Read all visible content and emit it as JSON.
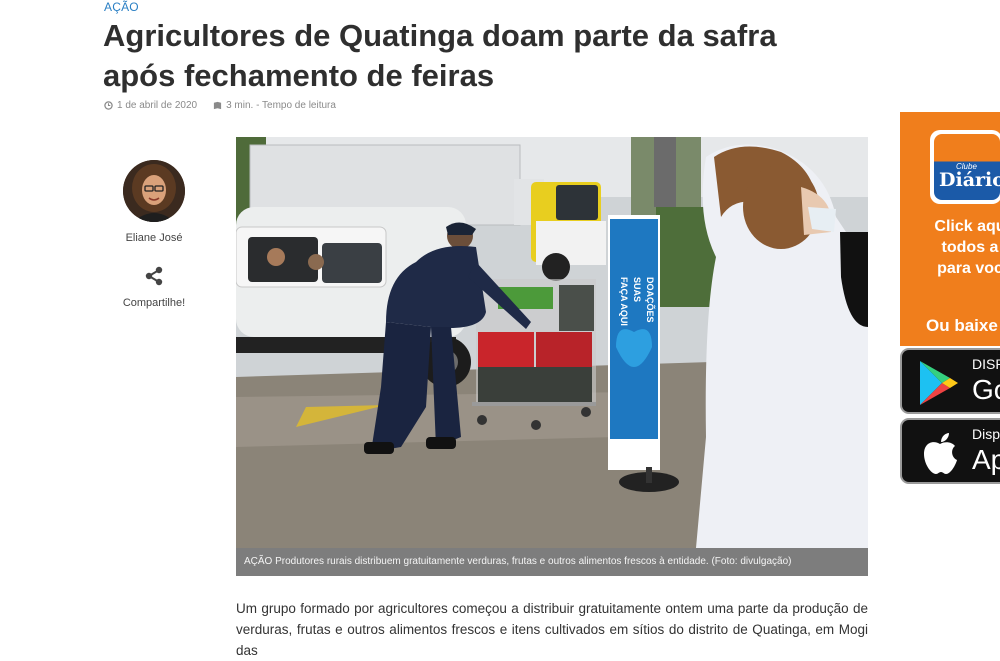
{
  "article": {
    "category": "AÇÃO",
    "title": "Agricultores de Quatinga doam parte da safra após fechamento de feiras",
    "date": "1 de abril de 2020",
    "reading_time": "3 min. - Tempo de leitura",
    "photo_caption": "AÇÃO Produtores rurais distribuem gratuitamente verduras, frutas e outros alimentos frescos à entidade. (Foto: divulgação)",
    "photo_banner_text": [
      "FAÇA AQUI",
      "SUAS",
      "DOAÇÕES"
    ],
    "body": "Um grupo formado por agricultores começou a distribuir gratuitamente ontem uma parte da produção de verduras, frutas e outros alimentos frescos e itens cultivados em sítios do distrito de Quatinga, em Mogi das"
  },
  "author": {
    "name": "Eliane José",
    "share_label": "Compartilhe!"
  },
  "ad": {
    "logo_small": "Clube",
    "logo_big": "Diário",
    "lines": [
      "Click aqu",
      "todos a",
      "para voc"
    ],
    "cta": "Ou baixe",
    "google_play": {
      "small": "DISP",
      "big": "Go"
    },
    "app_store": {
      "small": "Disp",
      "big": "Ap"
    },
    "accent_color": "#f07e1c",
    "brand_blue": "#1b5aa8"
  }
}
